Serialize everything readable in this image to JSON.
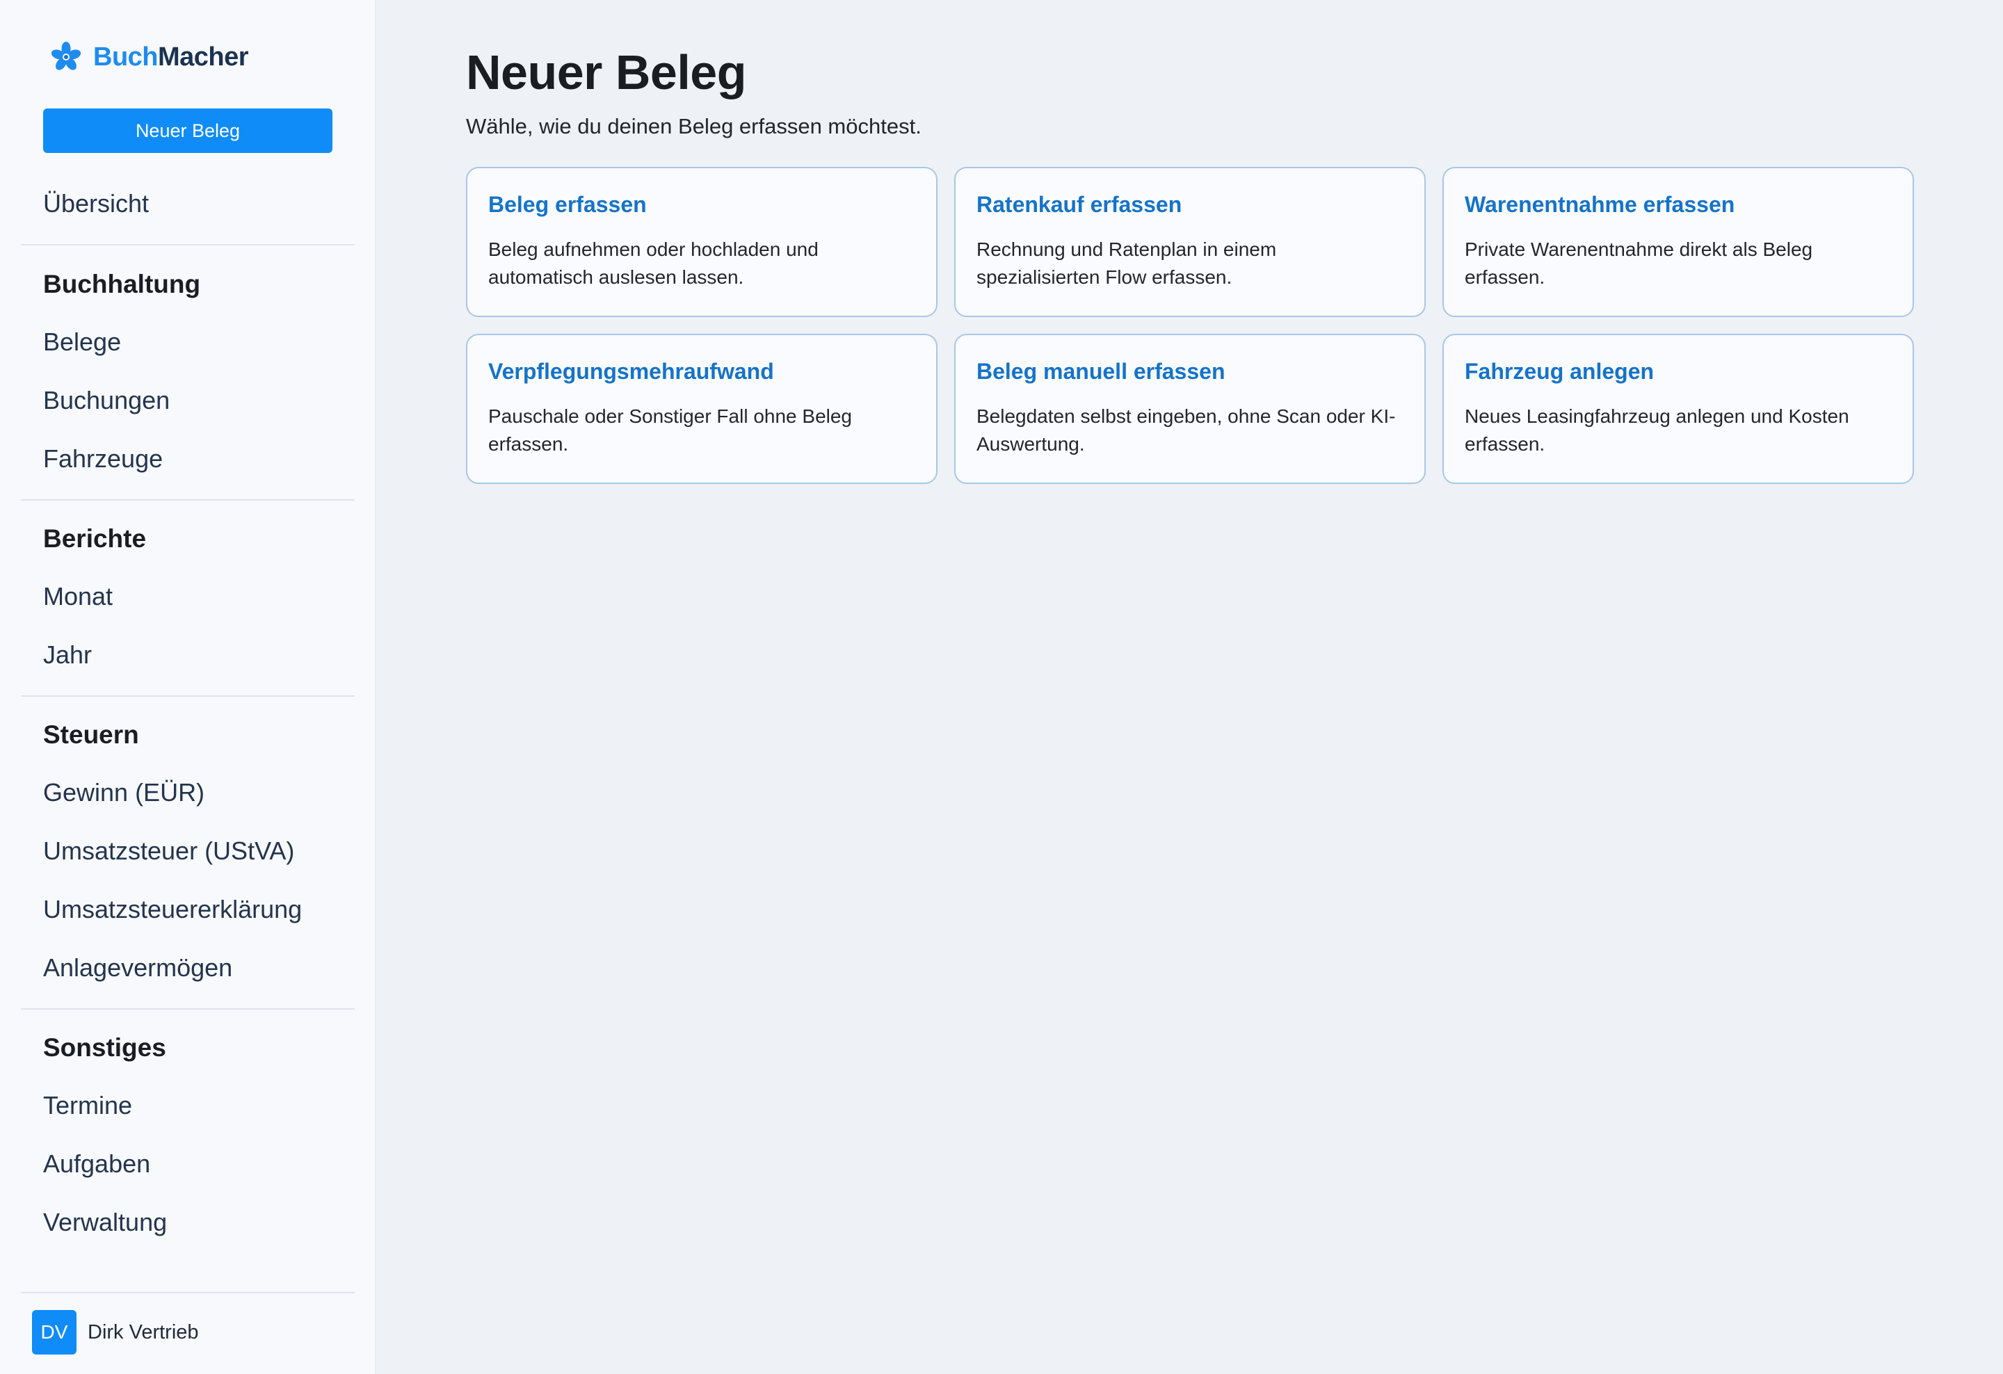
{
  "brand": {
    "name_part1": "Buch",
    "name_part2": "Macher"
  },
  "sidebar": {
    "new_button_label": "Neuer Beleg",
    "overview": "Übersicht",
    "sections": [
      {
        "heading": "Buchhaltung",
        "items": [
          "Belege",
          "Buchungen",
          "Fahrzeuge"
        ]
      },
      {
        "heading": "Berichte",
        "items": [
          "Monat",
          "Jahr"
        ]
      },
      {
        "heading": "Steuern",
        "items": [
          "Gewinn (EÜR)",
          "Umsatzsteuer (UStVA)",
          "Umsatzsteuererklärung",
          "Anlagevermögen"
        ]
      },
      {
        "heading": "Sonstiges",
        "items": [
          "Termine",
          "Aufgaben",
          "Verwaltung"
        ]
      }
    ],
    "user": {
      "initials": "DV",
      "name": "Dirk Vertrieb"
    }
  },
  "main": {
    "title": "Neuer Beleg",
    "subtitle": "Wähle, wie du deinen Beleg erfassen möchtest.",
    "cards": [
      {
        "title": "Beleg erfassen",
        "description": "Beleg aufnehmen oder hochladen und automatisch auslesen lassen."
      },
      {
        "title": "Ratenkauf erfassen",
        "description": "Rechnung und Ratenplan in einem spezialisierten Flow erfassen."
      },
      {
        "title": "Warenentnahme erfassen",
        "description": "Private Warenentnahme direkt als Beleg erfassen."
      },
      {
        "title": "Verpflegungsmehraufwand",
        "description": "Pauschale oder Sonstiger Fall ohne Beleg erfassen."
      },
      {
        "title": "Beleg manuell erfassen",
        "description": "Belegdaten selbst eingeben, ohne Scan oder KI-Auswertung."
      },
      {
        "title": "Fahrzeug anlegen",
        "description": "Neues Leasingfahrzeug anlegen und Kosten erfassen."
      }
    ]
  },
  "colors": {
    "accent": "#0f8cf7",
    "brand_blue": "#1e8bf0",
    "brand_dark": "#1b3350",
    "card_title": "#1573c9",
    "card_border": "#a9c6e6"
  },
  "icons": {
    "brand": "flower-logo-icon"
  }
}
